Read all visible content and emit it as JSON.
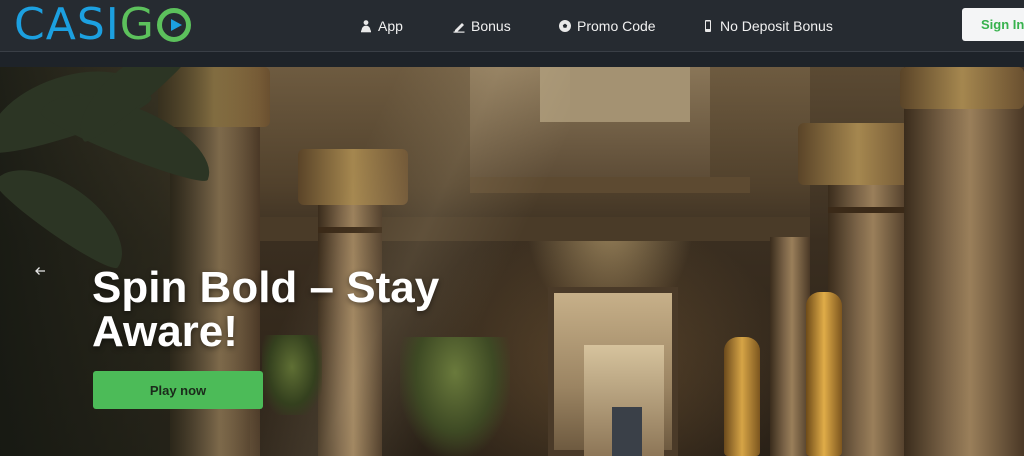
{
  "brand": {
    "part1": "CASI",
    "part2": "G",
    "icon": "play-circle-icon"
  },
  "nav": {
    "items": [
      {
        "label": "App",
        "icon": "app-person-icon"
      },
      {
        "label": "Bonus",
        "icon": "bonus-pen-icon"
      },
      {
        "label": "Promo Code",
        "icon": "promo-soccer-ball-icon"
      },
      {
        "label": "No Deposit Bonus",
        "icon": "no-deposit-phone-icon"
      }
    ],
    "signin_label": "Sign In"
  },
  "hero": {
    "headline": "Spin Bold – Stay Aware!",
    "cta_label": "Play now",
    "prev_icon": "arrow-left-icon"
  },
  "colors": {
    "brand_blue": "#1ca0e0",
    "brand_green": "#5cc15c",
    "header_bg": "#262b31",
    "cta_green": "#4cbb58",
    "signin_text": "#37b24d"
  }
}
